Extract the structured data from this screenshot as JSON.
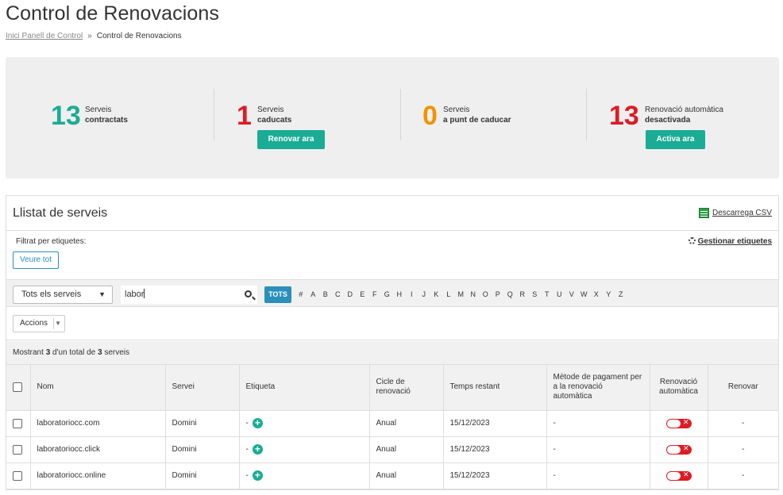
{
  "page": {
    "title": "Control de Renovacions",
    "breadcrumb": {
      "home": "Inici Panell de Control",
      "separator": "»",
      "current": "Control de Renovacions"
    }
  },
  "summary": {
    "stats": [
      {
        "number": "13",
        "line1": "Serveis",
        "line2": "contractats",
        "color": "#1aac94",
        "button": ""
      },
      {
        "number": "1",
        "line1": "Serveis",
        "line2": "caducats",
        "color": "#e01b24",
        "button": "Renovar ara"
      },
      {
        "number": "0",
        "line1": "Serveis",
        "line2": "a punt de caducar",
        "color": "#f39200",
        "button": ""
      },
      {
        "number": "13",
        "line1": "Renovació automàtica",
        "line2": "desactivada",
        "color": "#e01b24",
        "button": "Activa ara"
      }
    ]
  },
  "services": {
    "title": "Llistat de serveis",
    "csv_label": "Descarrega CSV",
    "filter_label": "Filtrat per etiquetes:",
    "view_all": "Veure tot",
    "manage_tags": "Gestionar etiquetes",
    "select_value": "Tots els serveis",
    "search_value": "labor",
    "letters": [
      "TOTS",
      "#",
      "A",
      "B",
      "C",
      "D",
      "E",
      "F",
      "G",
      "H",
      "I",
      "J",
      "K",
      "L",
      "M",
      "N",
      "O",
      "P",
      "Q",
      "R",
      "S",
      "T",
      "U",
      "V",
      "W",
      "X",
      "Y",
      "Z"
    ],
    "actions_label": "Accions",
    "showing": {
      "prefix": "Mostrant",
      "shown": "3",
      "middle": "d'un total de",
      "total": "3",
      "suffix": "serveis"
    },
    "columns": {
      "nom": "Nom",
      "servei": "Servei",
      "etiqueta": "Etiqueta",
      "cicle": "Cicle de renovació",
      "temps": "Temps restant",
      "metode": "Mètode de pagament per a la renovació automàtica",
      "renovacio": "Renovació automàtica",
      "renovar": "Renovar"
    },
    "rows": [
      {
        "nom": "laboratoriocc.com",
        "servei": "Domini",
        "etiqueta": "-",
        "cicle": "Anual",
        "temps": "15/12/2023",
        "metode": "-",
        "renovar": "-"
      },
      {
        "nom": "laboratoriocc.click",
        "servei": "Domini",
        "etiqueta": "-",
        "cicle": "Anual",
        "temps": "15/12/2023",
        "metode": "-",
        "renovar": "-"
      },
      {
        "nom": "laboratoriocc.online",
        "servei": "Domini",
        "etiqueta": "-",
        "cicle": "Anual",
        "temps": "15/12/2023",
        "metode": "-",
        "renovar": "-"
      }
    ]
  },
  "colors": {
    "accent": "#1aac94",
    "blue": "#2a8fbd",
    "danger": "#e01b24",
    "warning": "#f39200"
  }
}
